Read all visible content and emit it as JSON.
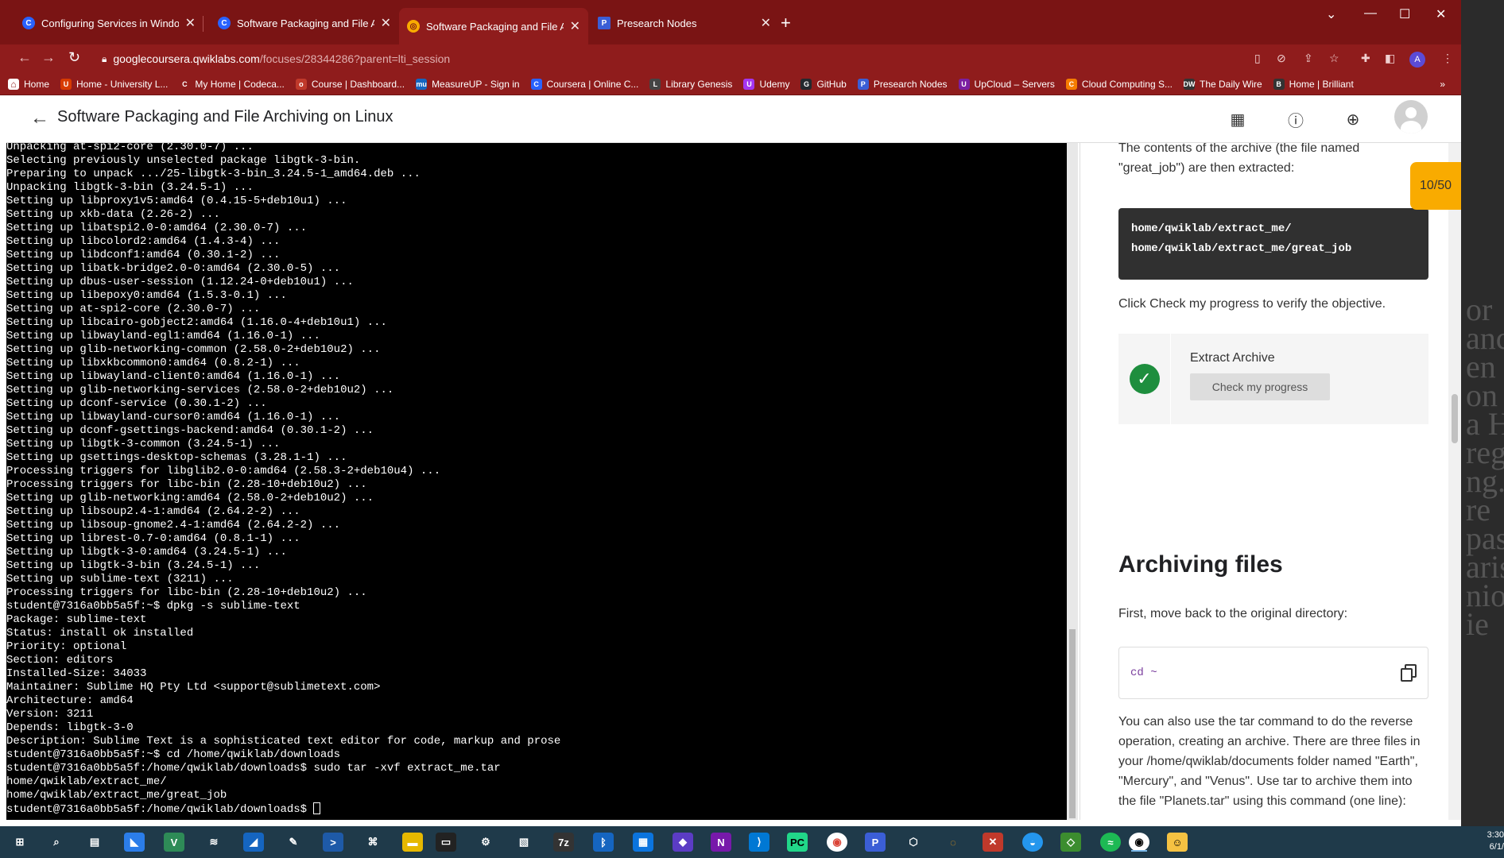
{
  "browser": {
    "tabs": [
      {
        "title": "Configuring Services in Windows",
        "favicon": "C",
        "color": "#2962ff"
      },
      {
        "title": "Software Packaging and File Arch",
        "favicon": "C",
        "color": "#2962ff"
      },
      {
        "title": "Software Packaging and File Arch",
        "favicon": "Q",
        "color": "#f9ab00"
      },
      {
        "title": "Presearch Nodes",
        "favicon": "P",
        "color": "#3b5ed6"
      }
    ],
    "url_host": "googlecoursera.qwiklabs.com",
    "url_path": "/focuses/28344286?parent=lti_session",
    "profile_initial": "A",
    "bookmarks": [
      {
        "label": "Home",
        "icon": "home-icon",
        "color": "#ffffff"
      },
      {
        "label": "Home - University L...",
        "icon": "U",
        "color": "#d83b01"
      },
      {
        "label": "My Home | Codeca...",
        "icon": "C",
        "color": "#8f1c1c"
      },
      {
        "label": "Course | Dashboard...",
        "icon": "o",
        "color": "#c0392b"
      },
      {
        "label": "MeasureUP - Sign in",
        "icon": "mu",
        "color": "#1565c0"
      },
      {
        "label": "Coursera | Online C...",
        "icon": "C",
        "color": "#2962ff"
      },
      {
        "label": "Library Genesis",
        "icon": "L",
        "color": "#444444"
      },
      {
        "label": "Udemy",
        "icon": "U",
        "color": "#a435f0"
      },
      {
        "label": "GitHub",
        "icon": "G",
        "color": "#24292e"
      },
      {
        "label": "Presearch Nodes",
        "icon": "P",
        "color": "#3b5ed6"
      },
      {
        "label": "UpCloud – Servers",
        "icon": "U",
        "color": "#7b1fa2"
      },
      {
        "label": "Cloud Computing S...",
        "icon": "C",
        "color": "#f57c00"
      },
      {
        "label": "The Daily Wire",
        "icon": "DW",
        "color": "#333333"
      },
      {
        "label": "Home | Brilliant",
        "icon": "B",
        "color": "#333333"
      }
    ],
    "bookmarks_overflow": "»"
  },
  "app": {
    "title": "Software Packaging and File Archiving on Linux"
  },
  "terminal": {
    "lines": [
      "Unpacking at-spi2-core (2.30.0-7) ...",
      "Selecting previously unselected package libgtk-3-bin.",
      "Preparing to unpack .../25-libgtk-3-bin_3.24.5-1_amd64.deb ...",
      "Unpacking libgtk-3-bin (3.24.5-1) ...",
      "Setting up libproxy1v5:amd64 (0.4.15-5+deb10u1) ...",
      "Setting up xkb-data (2.26-2) ...",
      "Setting up libatspi2.0-0:amd64 (2.30.0-7) ...",
      "Setting up libcolord2:amd64 (1.4.3-4) ...",
      "Setting up libdconf1:amd64 (0.30.1-2) ...",
      "Setting up libatk-bridge2.0-0:amd64 (2.30.0-5) ...",
      "Setting up dbus-user-session (1.12.24-0+deb10u1) ...",
      "Setting up libepoxy0:amd64 (1.5.3-0.1) ...",
      "Setting up at-spi2-core (2.30.0-7) ...",
      "Setting up libcairo-gobject2:amd64 (1.16.0-4+deb10u1) ...",
      "Setting up libwayland-egl1:amd64 (1.16.0-1) ...",
      "Setting up glib-networking-common (2.58.0-2+deb10u2) ...",
      "Setting up libxkbcommon0:amd64 (0.8.2-1) ...",
      "Setting up libwayland-client0:amd64 (1.16.0-1) ...",
      "Setting up glib-networking-services (2.58.0-2+deb10u2) ...",
      "Setting up dconf-service (0.30.1-2) ...",
      "Setting up libwayland-cursor0:amd64 (1.16.0-1) ...",
      "Setting up dconf-gsettings-backend:amd64 (0.30.1-2) ...",
      "Setting up libgtk-3-common (3.24.5-1) ...",
      "Setting up gsettings-desktop-schemas (3.28.1-1) ...",
      "Processing triggers for libglib2.0-0:amd64 (2.58.3-2+deb10u4) ...",
      "Processing triggers for libc-bin (2.28-10+deb10u2) ...",
      "Setting up glib-networking:amd64 (2.58.0-2+deb10u2) ...",
      "Setting up libsoup2.4-1:amd64 (2.64.2-2) ...",
      "Setting up libsoup-gnome2.4-1:amd64 (2.64.2-2) ...",
      "Setting up librest-0.7-0:amd64 (0.8.1-1) ...",
      "Setting up libgtk-3-0:amd64 (3.24.5-1) ...",
      "Setting up libgtk-3-bin (3.24.5-1) ...",
      "Setting up sublime-text (3211) ...",
      "Processing triggers for libc-bin (2.28-10+deb10u2) ...",
      "student@7316a0bb5a5f:~$ dpkg -s sublime-text",
      "Package: sublime-text",
      "Status: install ok installed",
      "Priority: optional",
      "Section: editors",
      "Installed-Size: 34033",
      "Maintainer: Sublime HQ Pty Ltd <support@sublimetext.com>",
      "Architecture: amd64",
      "Version: 3211",
      "Depends: libgtk-3-0",
      "Description: Sublime Text is a sophisticated text editor for code, markup and prose",
      "student@7316a0bb5a5f:~$ cd /home/qwiklab/downloads",
      "student@7316a0bb5a5f:/home/qwiklab/downloads$ sudo tar -xvf extract_me.tar",
      "home/qwiklab/extract_me/",
      "home/qwiklab/extract_me/great_job"
    ],
    "prompt": "student@7316a0bb5a5f:/home/qwiklab/downloads$ "
  },
  "panel": {
    "intro_text": "The contents of the archive (the file named \"great_job\") are then extracted:",
    "extract_output": "home/qwiklab/extract_me/\nhome/qwiklab/extract_me/great_job",
    "check_instruction": "Click Check my progress to verify the objective.",
    "check_title": "Extract Archive",
    "check_button": "Check my progress",
    "section_heading": "Archiving files",
    "move_back_text": "First, move back to the original directory:",
    "cd_command": "cd ~",
    "archive_text": "You can also use the tar command to do the reverse operation, creating an archive. There are three files in your /home/qwiklab/documents folder named \"Earth\", \"Mercury\", and \"Venus\". Use tar to archive them into the file \"Planets.tar\" using this command (one line):",
    "progress_badge": "10/50"
  },
  "taskbar": {
    "clock_time": "3:30",
    "clock_date": "6/1/"
  },
  "desktop": {
    "wallpaper_text": [
      "or",
      "ance",
      "en",
      "on",
      "a H",
      "reg",
      "ng.",
      "re",
      "pas",
      "aris",
      "nio",
      "ie"
    ]
  }
}
